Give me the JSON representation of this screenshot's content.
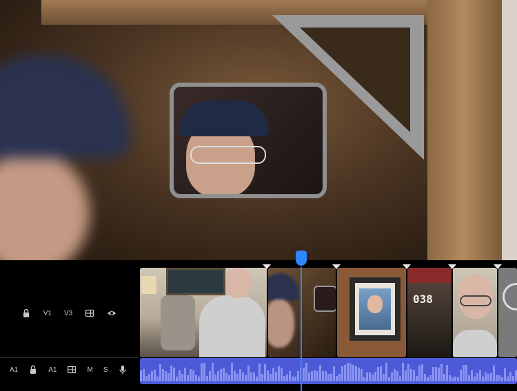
{
  "track_controls": {
    "video_row": {
      "lock_icon": "lock-icon",
      "source_label": "V1",
      "target_label": "V3",
      "film_icon": "film-strip-icon",
      "eye_icon": "eye-icon"
    },
    "audio_row": {
      "source_label": "A1",
      "lock_icon": "lock-icon",
      "target_label": "A1",
      "film_icon": "film-strip-icon",
      "mute_label": "M",
      "solo_label": "S",
      "mic_icon": "microphone-icon"
    }
  },
  "timeline": {
    "clips": [
      {
        "id": "interview-armchair",
        "thumbnail_text": ""
      },
      {
        "id": "mirror-closeup",
        "thumbnail_text": ""
      },
      {
        "id": "framed-portrait",
        "thumbnail_text": ""
      },
      {
        "id": "cap-closeup",
        "thumbnail_text": "038"
      },
      {
        "id": "interview-closeup",
        "thumbnail_text": ""
      },
      {
        "id": "partial-clip",
        "thumbnail_text": ""
      }
    ],
    "marker_count": 5
  },
  "colors": {
    "playhead": "#2e86ff",
    "audio_track": "#4d5ad8",
    "waveform": "#8a94f0",
    "editor_bg": "#000000"
  }
}
